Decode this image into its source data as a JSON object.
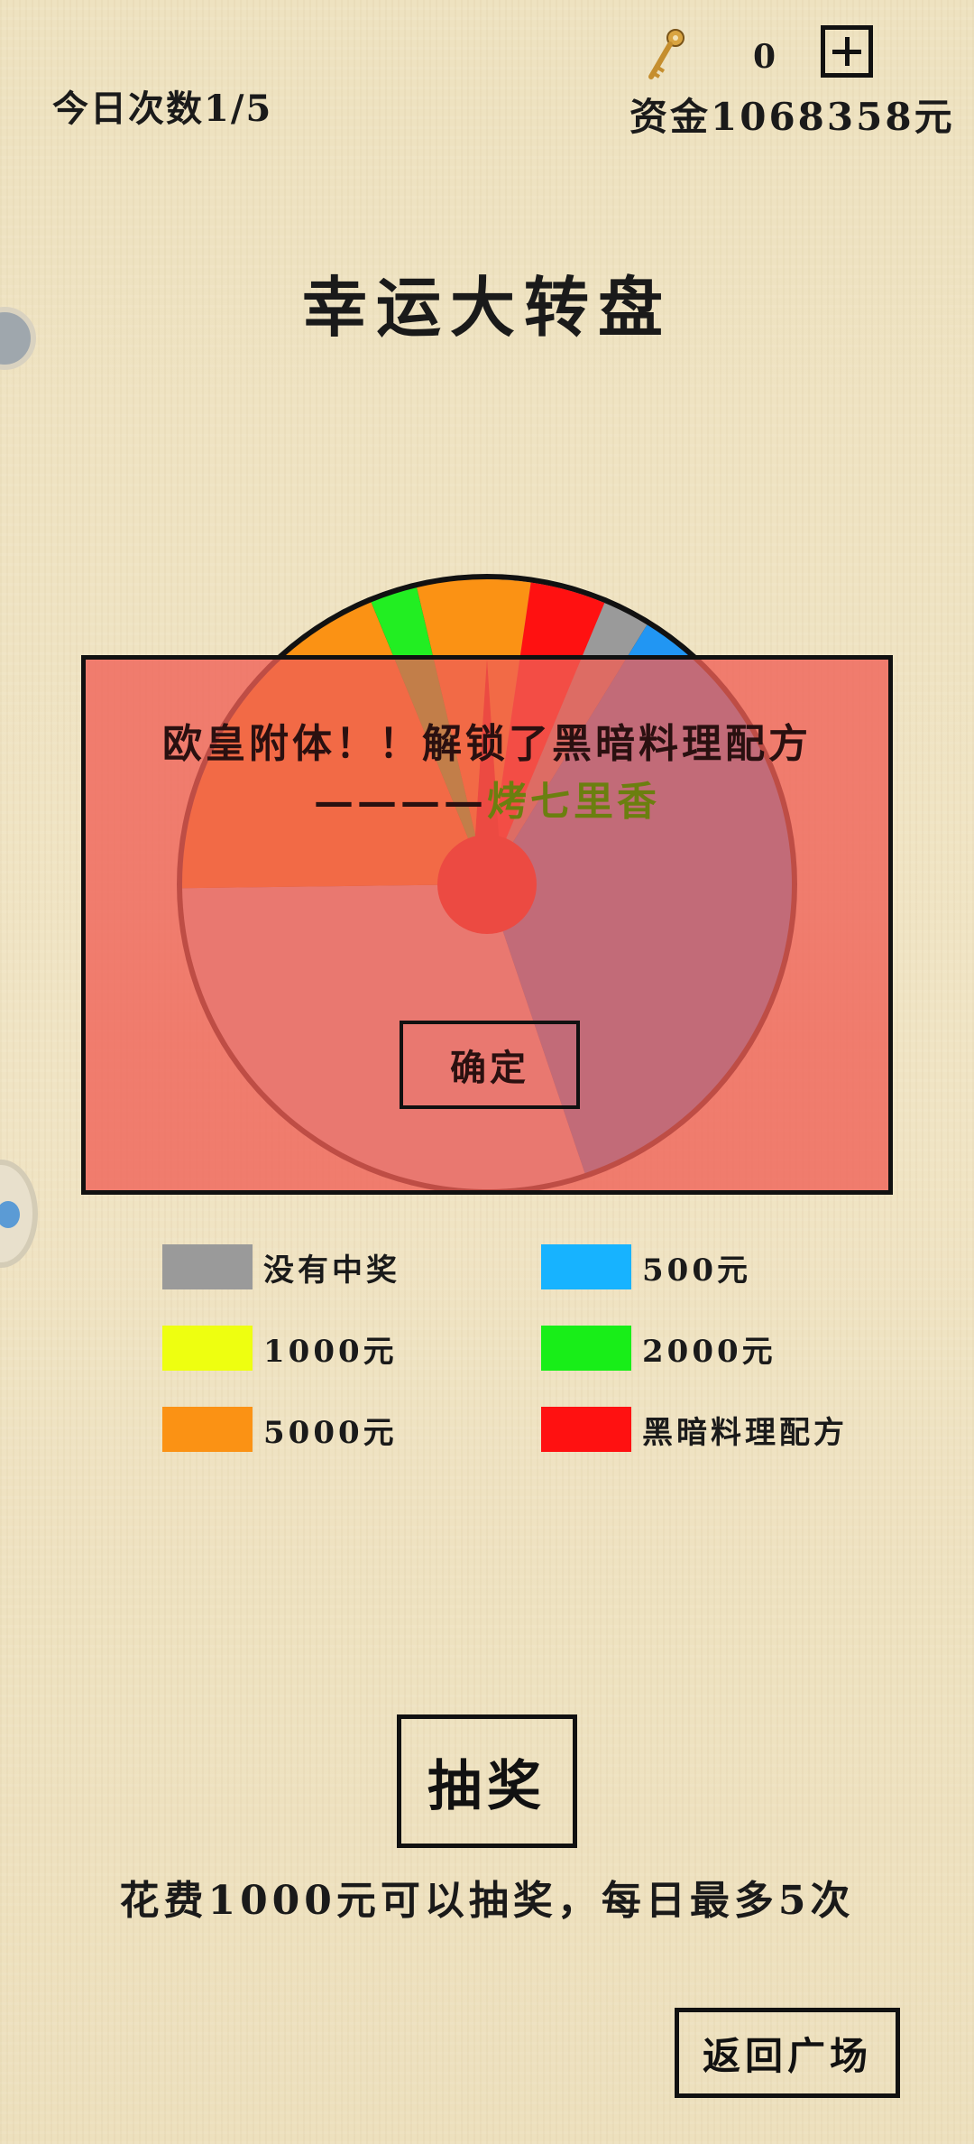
{
  "header": {
    "daily_label": "今日次数1/5",
    "key_icon": "key-icon",
    "key_count": "0",
    "plus_icon": "plus-icon",
    "money_label": "资金1068358元"
  },
  "title": "幸运大转盘",
  "wheel": {
    "segments": [
      {
        "label": "没有中奖",
        "color": "#9a9a9a",
        "share": 0.088
      },
      {
        "label": "黑暗料理配方",
        "color": "#2196f3",
        "share": 0.36
      },
      {
        "label": "黑暗料理配方",
        "color": "#cfcfcf",
        "share": 0.3
      },
      {
        "label": "5000元",
        "color": "#fb9214",
        "share": 0.19
      },
      {
        "label": "2000元",
        "color": "#22ee22",
        "share": 0.025
      },
      {
        "label": "5000元",
        "color": "#fb9214",
        "share": 0.06
      },
      {
        "label": "黑暗料理配方",
        "color": "#ff1111",
        "share": 0.04
      }
    ],
    "pointer_color": "#e00000",
    "rim_color": "#111111"
  },
  "dialog": {
    "message_prefix": "欧皇附体！！解锁了黑暗料理配方————",
    "message_item": "烤七里香",
    "confirm_label": "确定"
  },
  "legend": [
    {
      "label": "没有中奖",
      "color": "#9a9a9a"
    },
    {
      "label": "500元",
      "color": "#17b3ff"
    },
    {
      "label": "1000元",
      "color": "#eeff10"
    },
    {
      "label": "2000元",
      "color": "#18ee18"
    },
    {
      "label": "5000元",
      "color": "#fb9214"
    },
    {
      "label": "黑暗料理配方",
      "color": "#ff1111"
    }
  ],
  "actions": {
    "draw_label": "抽奖",
    "draw_note": "花费1000元可以抽奖，每日最多5次",
    "back_label": "返回广场"
  }
}
